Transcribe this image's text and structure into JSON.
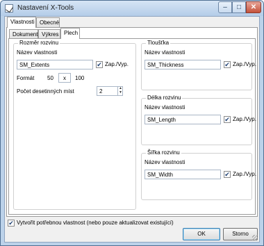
{
  "window": {
    "title": "Nastavení X-Tools",
    "min_icon": "minimize-icon",
    "max_icon": "maximize-icon",
    "close_icon": "close-icon"
  },
  "top_tabs": [
    {
      "label": "Vlastnosti"
    },
    {
      "label": "Obecné"
    }
  ],
  "sub_tabs": [
    {
      "label": "Dokument"
    },
    {
      "label": "Výkres"
    },
    {
      "label": "Plech"
    }
  ],
  "left_group": {
    "title": "Rozměr rozvinu",
    "name_label": "Název vlastnosti",
    "name_value": "SM_Extents",
    "checkbox_label": "Zap./Vyp.",
    "checked": true,
    "format_label": "Formát",
    "format_w": "50",
    "format_x": "x",
    "format_h": "100",
    "decimals_label": "Počet desetinných míst",
    "decimals_value": "2"
  },
  "thickness_group": {
    "title": "Tloušťka",
    "name_label": "Název vlastnosti",
    "name_value": "SM_Thickness",
    "checkbox_label": "Zap./Vyp.",
    "checked": true
  },
  "length_group": {
    "title": "Délka rozvinu",
    "name_label": "Název vlastnosti",
    "name_value": "SM_Length",
    "checkbox_label": "Zap./Vyp.",
    "checked": true
  },
  "width_group": {
    "title": "Šířka rozvinu",
    "name_label": "Název vlastnosti",
    "name_value": "SM_Width",
    "checkbox_label": "Zap./Vyp.",
    "checked": true
  },
  "footer": {
    "create_label": "Vytvořit potřebnou vlastnost (nebo pouze aktualizovat existující)",
    "create_checked": true,
    "ok_label": "OK",
    "cancel_label": "Storno"
  },
  "check_glyph": "✔"
}
